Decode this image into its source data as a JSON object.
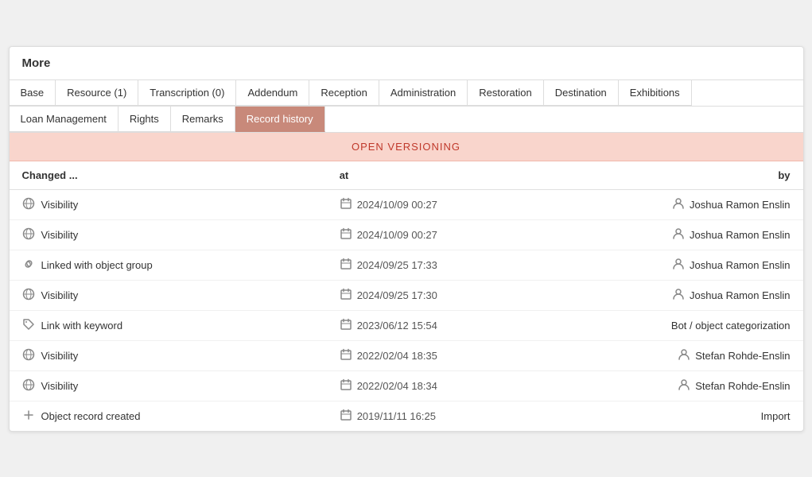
{
  "header": {
    "title": "More"
  },
  "tabs_row1": [
    {
      "label": "Base",
      "active": false
    },
    {
      "label": "Resource (1)",
      "active": false
    },
    {
      "label": "Transcription (0)",
      "active": false
    },
    {
      "label": "Addendum",
      "active": false
    },
    {
      "label": "Reception",
      "active": false
    },
    {
      "label": "Administration",
      "active": false
    },
    {
      "label": "Restoration",
      "active": false
    },
    {
      "label": "Destination",
      "active": false
    },
    {
      "label": "Exhibitions",
      "active": false
    }
  ],
  "tabs_row2": [
    {
      "label": "Loan Management",
      "active": false
    },
    {
      "label": "Rights",
      "active": false
    },
    {
      "label": "Remarks",
      "active": false
    },
    {
      "label": "Record history",
      "active": true
    }
  ],
  "versioning_banner": "OPEN VERSIONING",
  "table": {
    "headers": {
      "changed": "Changed ...",
      "at": "at",
      "by": "by"
    },
    "rows": [
      {
        "icon": "globe",
        "changed": "Visibility",
        "at": "2024/10/09 00:27",
        "by_icon": "user",
        "by": "Joshua Ramon Enslin"
      },
      {
        "icon": "globe",
        "changed": "Visibility",
        "at": "2024/10/09 00:27",
        "by_icon": "user",
        "by": "Joshua Ramon Enslin"
      },
      {
        "icon": "link",
        "changed": "Linked with object group",
        "at": "2024/09/25 17:33",
        "by_icon": "user",
        "by": "Joshua Ramon Enslin"
      },
      {
        "icon": "globe",
        "changed": "Visibility",
        "at": "2024/09/25 17:30",
        "by_icon": "user",
        "by": "Joshua Ramon Enslin"
      },
      {
        "icon": "tag",
        "changed": "Link with keyword",
        "at": "2023/06/12 15:54",
        "by_icon": "none",
        "by": "Bot / object categorization"
      },
      {
        "icon": "globe",
        "changed": "Visibility",
        "at": "2022/02/04 18:35",
        "by_icon": "user",
        "by": "Stefan Rohde-Enslin"
      },
      {
        "icon": "globe",
        "changed": "Visibility",
        "at": "2022/02/04 18:34",
        "by_icon": "user",
        "by": "Stefan Rohde-Enslin"
      },
      {
        "icon": "plus",
        "changed": "Object record created",
        "at": "2019/11/11 16:25",
        "by_icon": "none",
        "by": "Import"
      }
    ]
  }
}
